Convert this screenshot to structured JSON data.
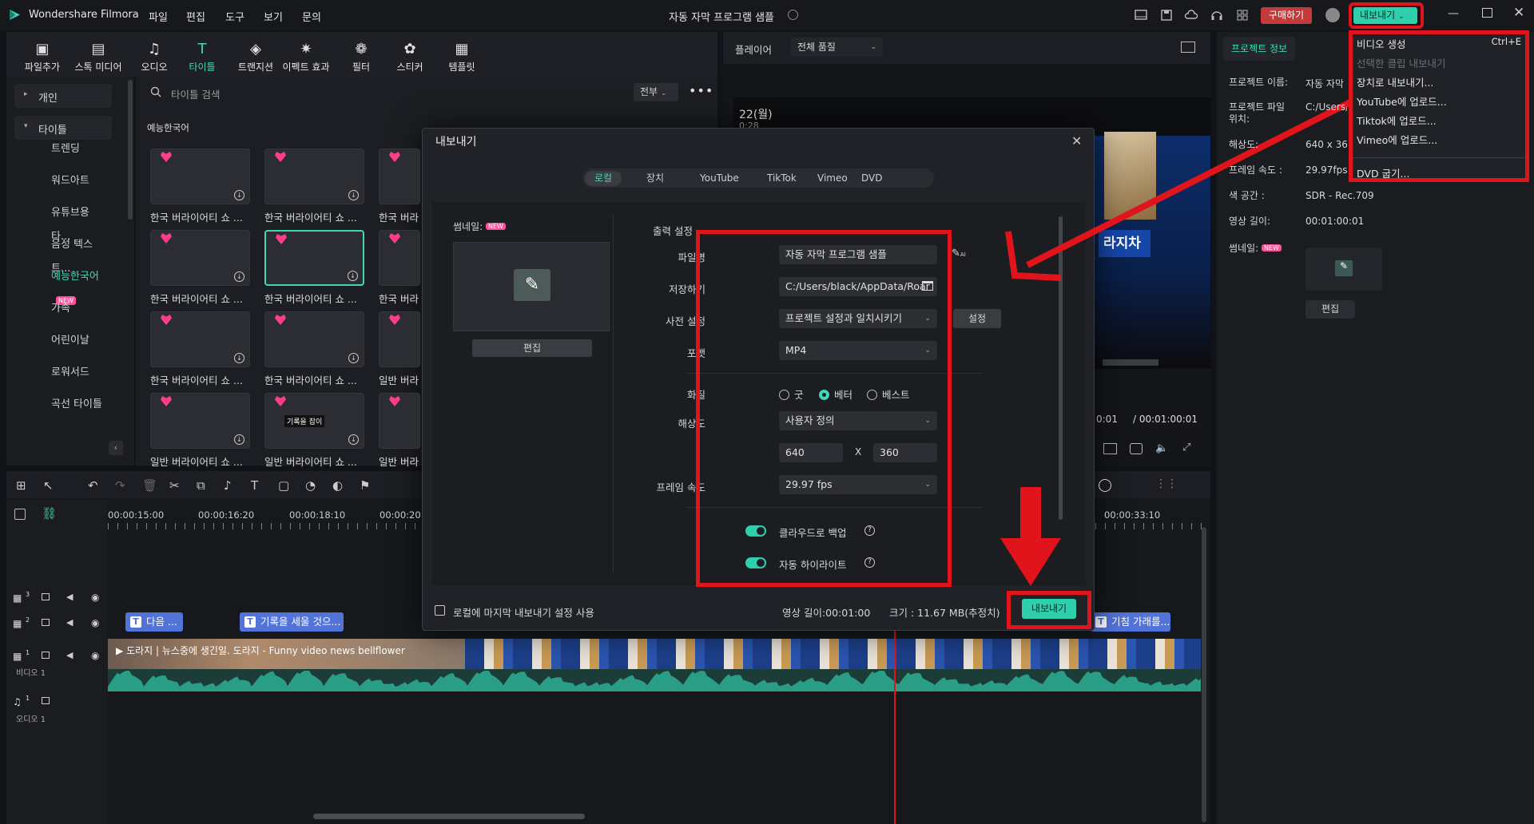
{
  "app": {
    "name": "Wondershare Filmora",
    "project_title": "자동 자막 프로그램 샘플"
  },
  "menu": [
    "파일",
    "편집",
    "도구",
    "보기",
    "문의"
  ],
  "top_right": {
    "buy": "구매하기",
    "export": "내보내기"
  },
  "toolbar": [
    {
      "label": "파일추가",
      "icon": "import-icon"
    },
    {
      "label": "스톡 미디어",
      "icon": "stock-media-icon"
    },
    {
      "label": "오디오",
      "icon": "music-note-icon"
    },
    {
      "label": "타이틀",
      "icon": "title-t-icon",
      "active": true
    },
    {
      "label": "트랜지션",
      "icon": "transition-icon"
    },
    {
      "label": "이펙트 효과",
      "icon": "effects-icon"
    },
    {
      "label": "필터",
      "icon": "filter-icon"
    },
    {
      "label": "스티커",
      "icon": "sticker-icon"
    },
    {
      "label": "템플릿",
      "icon": "template-icon"
    }
  ],
  "sidebar": {
    "groups": [
      {
        "label": "개인",
        "expanded": false
      },
      {
        "label": "타이틀",
        "expanded": true
      }
    ],
    "items": [
      "트렌딩",
      "워드아트",
      "유튜브용 타...",
      "음성 텍스트...",
      "예능한국어",
      "가족",
      "어린이날",
      "로워서드",
      "곡선 타이틀"
    ],
    "active_item": "예능한국어",
    "new_badge": "NEW"
  },
  "library": {
    "search_placeholder": "타이틀 검색",
    "filter": "전부",
    "section": "예능한국어",
    "thumbs": [
      "한국 버라이어티 쇼 ...",
      "한국 버라이어티 쇼 ...",
      "한국 버라",
      "한국 버라이어티 쇼 ...",
      "한국 버라이어티 쇼 ...",
      "한국 버라",
      "한국 버라이어티 쇼 ...",
      "한국 버라이어티 쇼 ...",
      "일반 버라",
      "일반 버라이어티 쇼 ...",
      "일반 버라이어티 쇼 ...",
      "일반 버라"
    ],
    "thumb_texts": [
      "기록을 잡이"
    ]
  },
  "player": {
    "label": "플레이어",
    "quality": "전체 품질",
    "date_text": "22(월)",
    "time_small": "0:28",
    "overlay_text": "라지차",
    "current_time": "0:01",
    "total_time": "/ 00:01:00:01"
  },
  "project_info": {
    "tab": "프로젝트 정보",
    "rows": [
      {
        "label": "프로젝트 이름:",
        "value": "자동 자막"
      },
      {
        "label": "프로젝트 파일 위치:",
        "value": "C:/Users/"
      },
      {
        "label": "해상도:",
        "value": "640 x 36"
      },
      {
        "label": "프레임 속도 :",
        "value": "29.97fps"
      },
      {
        "label": "색 공간 :",
        "value": "SDR - Rec.709"
      },
      {
        "label": "영상 길이:",
        "value": "00:01:00:01"
      }
    ],
    "thumb_label": "썸네일:",
    "new_badge": "NEW",
    "edit": "편집"
  },
  "export_menu": {
    "items": [
      {
        "label": "비디오 생성",
        "shortcut": "Ctrl+E",
        "disabled": false
      },
      {
        "label": "선택한 클립 내보내기",
        "shortcut": "",
        "disabled": true
      },
      {
        "label": "장치로 내보내기...",
        "shortcut": "",
        "disabled": false
      },
      {
        "label": "YouTube에 업로드...",
        "shortcut": "",
        "disabled": false
      },
      {
        "label": "Tiktok에 업로드...",
        "shortcut": "",
        "disabled": false
      },
      {
        "label": "Vimeo에 업로드...",
        "shortcut": "",
        "disabled": false
      },
      {
        "label": "DVD 굽기...",
        "shortcut": "",
        "disabled": false
      }
    ]
  },
  "dialog": {
    "title": "내보내기",
    "tabs": [
      "로컬",
      "장치",
      "YouTube",
      "TikTok",
      "Vimeo",
      "DVD"
    ],
    "active_tab": "로컬",
    "thumbnail_label": "썸네일:",
    "new_badge": "NEW",
    "thumb_edit": "편집",
    "output_settings": "출력 설정",
    "filename_label": "파일명",
    "filename": "자동 자막 프로그램 샘플",
    "save_label": "저장하기",
    "save_path": "C:/Users/black/AppData/Roar",
    "preset_label": "사전 설정",
    "preset": "프로젝트 설정과 일치시키기",
    "preset_btn": "설정",
    "format_label": "포맷",
    "format": "MP4",
    "quality_label": "화질",
    "quality_options": [
      "굿",
      "베터",
      "베스트"
    ],
    "quality_selected": "베터",
    "resolution_label": "해상도",
    "resolution": "사용자 정의",
    "width": "640",
    "x": "X",
    "height": "360",
    "fps_label": "프레임 속도",
    "fps": "29.97 fps",
    "cloud_backup": "클라우드로 백업",
    "auto_highlight": "자동 하이라이트",
    "last_settings": "로컬에 마지막 내보내기 설정 사용",
    "duration": "영상 길이:00:01:00",
    "size": "크기 : 11.67 MB(추정치)",
    "export_btn": "내보내기"
  },
  "timeline": {
    "ruler": [
      "00:00:15:00",
      "00:00:16:20",
      "00:00:18:10",
      "00:00:20",
      "00:00:33:10"
    ],
    "clips_track2": [
      "다음 ...",
      "기록을 세울 것으...",
      "기침 가래를..."
    ],
    "video_clip": "뉴스중에 생긴일. 도라지 - Funny video news bellflower",
    "video_clip_prefix": "도라지",
    "track_labels": [
      "비디오 1",
      "오디오 1"
    ],
    "track_nums": [
      "3",
      "2",
      "1",
      "1"
    ]
  },
  "colors": {
    "accent": "#3fd9b7",
    "red_annotation": "#e1141c",
    "title_clip": "#5273d8",
    "audio": "#1f8f7a"
  }
}
